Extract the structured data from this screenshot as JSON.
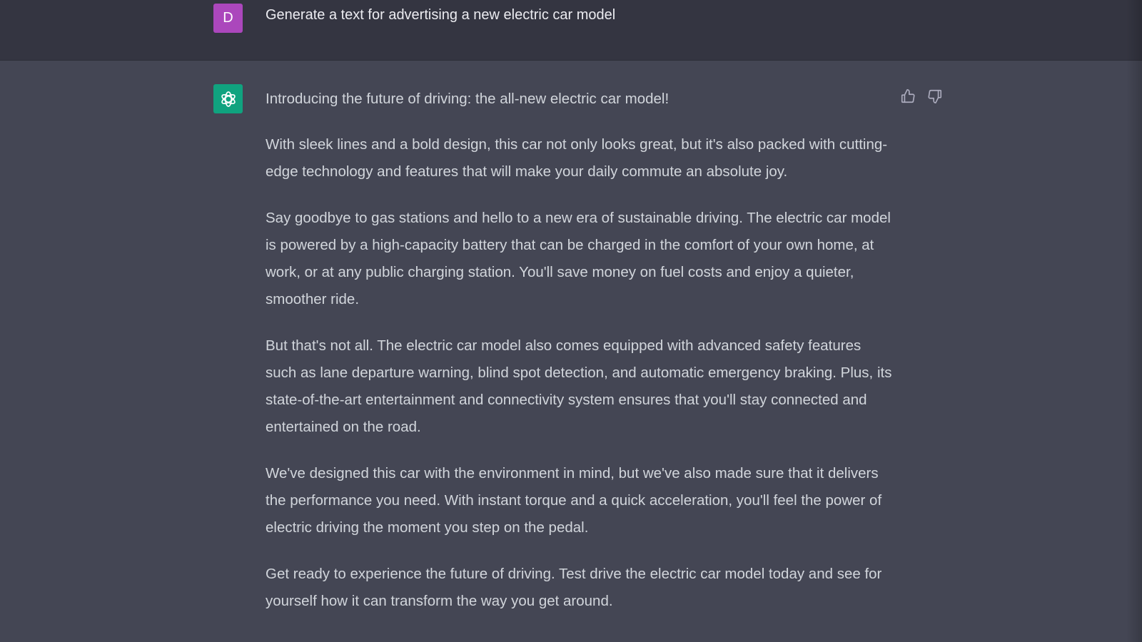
{
  "colors": {
    "user_row_bg": "#343541",
    "assistant_row_bg": "#444654",
    "user_avatar": "#ab47bc",
    "assistant_avatar": "#10a37f",
    "text": "#d1d5db"
  },
  "user_message": {
    "avatar_initial": "D",
    "text": "Generate a text for advertising a new electric car model"
  },
  "assistant_message": {
    "avatar_icon": "openai-logo-icon",
    "feedback": {
      "thumbs_up_icon": "thumbs-up-icon",
      "thumbs_down_icon": "thumbs-down-icon"
    },
    "paragraphs": [
      "Introducing the future of driving: the all-new electric car model!",
      "With sleek lines and a bold design, this car not only looks great, but it's also packed with cutting-edge technology and features that will make your daily commute an absolute joy.",
      "Say goodbye to gas stations and hello to a new era of sustainable driving. The electric car model is powered by a high-capacity battery that can be charged in the comfort of your own home, at work, or at any public charging station. You'll save money on fuel costs and enjoy a quieter, smoother ride.",
      "But that's not all. The electric car model also comes equipped with advanced safety features such as lane departure warning, blind spot detection, and automatic emergency braking. Plus, its state-of-the-art entertainment and connectivity system ensures that you'll stay connected and entertained on the road.",
      "We've designed this car with the environment in mind, but we've also made sure that it delivers the performance you need. With instant torque and a quick acceleration, you'll feel the power of electric driving the moment you step on the pedal.",
      "Get ready to experience the future of driving. Test drive the electric car model today and see for yourself how it can transform the way you get around."
    ]
  }
}
